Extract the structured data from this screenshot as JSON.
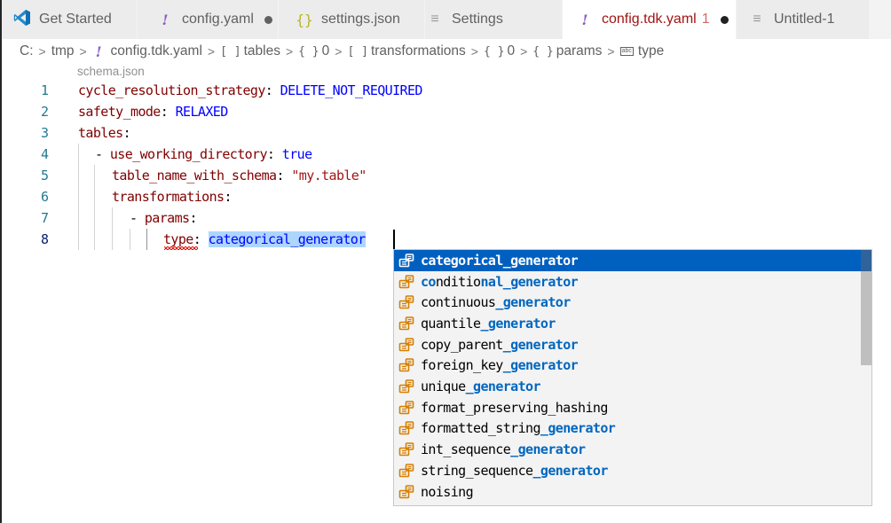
{
  "tabs": [
    {
      "label": "Get Started",
      "icon": "vscode-logo-icon",
      "active": false,
      "dirty": false
    },
    {
      "label": "config.yaml",
      "icon": "yaml-icon",
      "active": false,
      "dirty": true
    },
    {
      "label": "settings.json",
      "icon": "json-icon",
      "active": false,
      "dirty": false
    },
    {
      "label": "Settings",
      "icon": "settings-lines-icon",
      "active": false,
      "dirty": false
    },
    {
      "label": "config.tdk.yaml",
      "icon": "yaml-icon",
      "active": true,
      "dirty": true,
      "problems": "1"
    },
    {
      "label": "Untitled-1",
      "icon": "text-lines-icon",
      "active": false,
      "dirty": false
    }
  ],
  "icons": {
    "excl": "!",
    "braces": "{}",
    "lines": "≡",
    "brackets": "[ ]",
    "object": "{ }",
    "chevron": ">",
    "abc": "abc"
  },
  "breadcrumb": [
    {
      "label": "C:",
      "icon": ""
    },
    {
      "label": "tmp",
      "icon": ""
    },
    {
      "label": "config.tdk.yaml",
      "icon": "yaml"
    },
    {
      "label": "tables",
      "icon": "array"
    },
    {
      "label": "0",
      "icon": "object"
    },
    {
      "label": "transformations",
      "icon": "array"
    },
    {
      "label": "0",
      "icon": "object"
    },
    {
      "label": "params",
      "icon": "object"
    },
    {
      "label": "type",
      "icon": "string"
    }
  ],
  "schema_hint": "schema.json",
  "editor": {
    "lines": [
      {
        "num": "1",
        "key": "cycle_resolution_strategy",
        "value": "DELETE_NOT_REQUIRED"
      },
      {
        "num": "2",
        "key": "safety_mode",
        "value": "RELAXED"
      },
      {
        "num": "3",
        "key": "tables",
        "value": ""
      },
      {
        "num": "4",
        "prefix": "- ",
        "key": "use_working_directory",
        "value": "true"
      },
      {
        "num": "5",
        "key": "table_name_with_schema",
        "value": "\"my.table\""
      },
      {
        "num": "6",
        "key": "transformations",
        "value": ""
      },
      {
        "num": "7",
        "prefix": "- ",
        "key": "params",
        "value": ""
      },
      {
        "num": "8",
        "key": "type",
        "value": "categorical_generator"
      }
    ],
    "colon": ":"
  },
  "suggestions": {
    "items": [
      {
        "pre": "",
        "match": "categorical_generator",
        "post": ""
      },
      {
        "pre": "co",
        "mid": "nditio",
        "match": "nal_generator",
        "post": ""
      },
      {
        "pre": "continuous",
        "match": "_generator",
        "post": ""
      },
      {
        "pre": "quantile",
        "match": "_generator",
        "post": ""
      },
      {
        "pre": "copy_parent",
        "match": "_generator",
        "post": ""
      },
      {
        "pre": "foreign_key",
        "match": "_generator",
        "post": ""
      },
      {
        "pre": "unique",
        "match": "_generator",
        "post": ""
      },
      {
        "pre": "format_preserving_hashing",
        "match": "",
        "post": ""
      },
      {
        "pre": "formatted_string",
        "match": "_generator",
        "post": ""
      },
      {
        "pre": "int_sequence",
        "match": "_generator",
        "post": ""
      },
      {
        "pre": "string_sequence",
        "match": "_generator",
        "post": ""
      },
      {
        "pre": "noising",
        "match": "",
        "post": ""
      }
    ],
    "focused_index": 0,
    "scroll_fraction_visible": 0.45
  },
  "colors": {
    "accent": "#0060c0",
    "key": "#800000",
    "value": "#0000ff",
    "string": "#a31515",
    "line_number": "#237893",
    "match_highlight": "#0066bf",
    "enum_icon": "#d67e00"
  }
}
